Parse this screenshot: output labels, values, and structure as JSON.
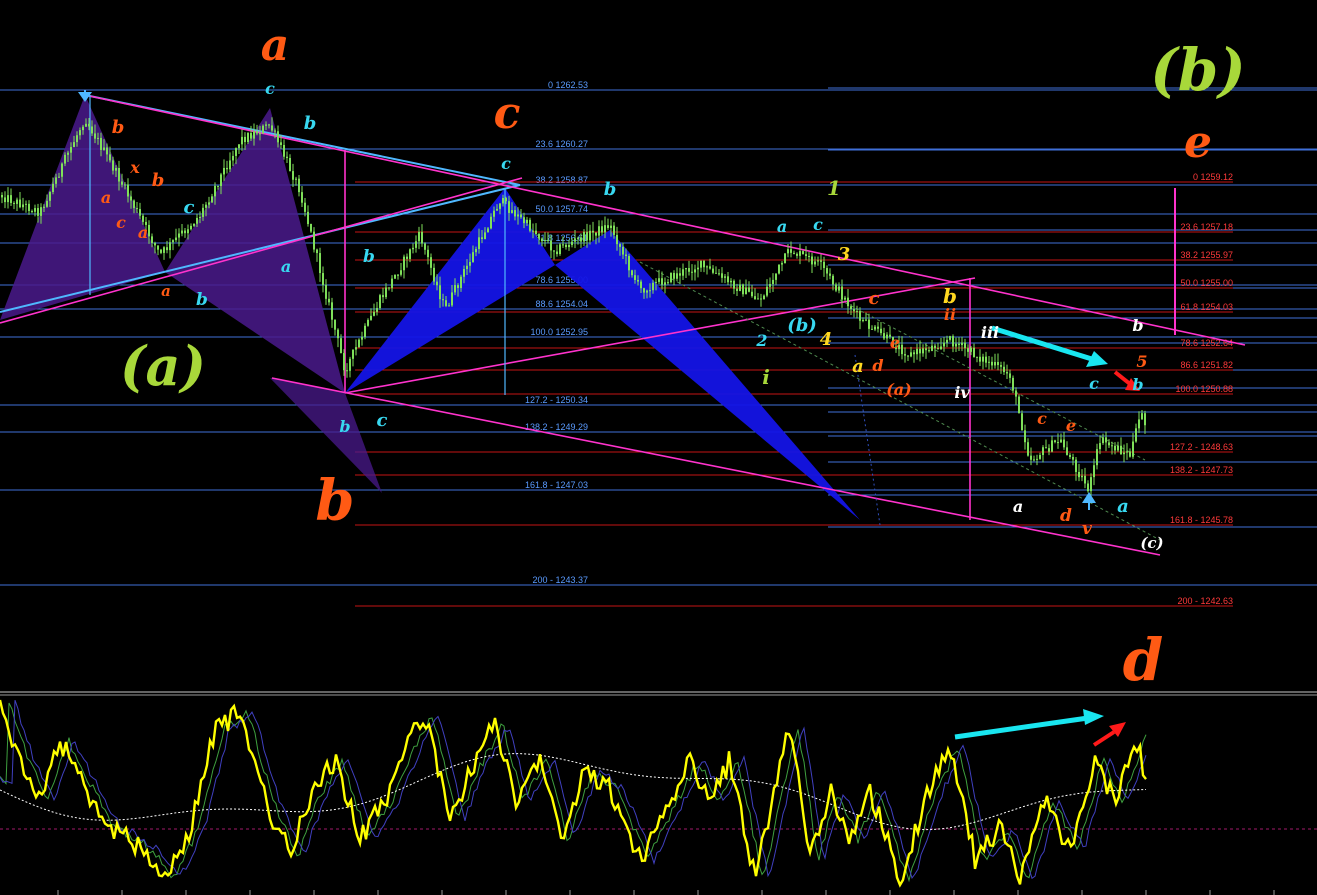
{
  "chart_data": [
    {
      "type": "line",
      "title": "",
      "description_note": "",
      "fib_left": [
        {
          "label": "0 1262.53"
        },
        {
          "label": "23.6 1260.27"
        },
        {
          "label": "38.2 1258.87"
        },
        {
          "label": "50.0 1257.74"
        },
        {
          "label": "61.8 1256.61"
        },
        {
          "label": "78.6 1255.00"
        },
        {
          "label": "88.6 1254.04"
        },
        {
          "label": "100.0 1252.95"
        },
        {
          "label": "127.2 - 1250.34"
        },
        {
          "label": "138.2 - 1249.29"
        },
        {
          "label": "161.8 - 1247.03"
        },
        {
          "label": "200 - 1243.37"
        }
      ],
      "fib_right": [
        {
          "label": "0 1259.12"
        },
        {
          "label": "23.6 1257.18"
        },
        {
          "label": "38.2 1255.97"
        },
        {
          "label": "50.0 1255.00"
        },
        {
          "label": "61.8 1254.03"
        },
        {
          "label": "78.6 1252.64"
        },
        {
          "label": "86.6 1251.82"
        },
        {
          "label": "100.0 1250.88"
        },
        {
          "label": "127.2 - 1248.63"
        },
        {
          "label": "138.2 - 1247.73"
        },
        {
          "label": "161.8 - 1245.78"
        },
        {
          "label": "200 - 1242.63"
        }
      ],
      "wave_labels": {
        "big": [
          "a",
          "c",
          "b",
          "(a)",
          "(b)",
          "e",
          "d"
        ],
        "small": [
          "b",
          "x",
          "b",
          "a",
          "c",
          "a",
          "a",
          "c",
          "b",
          "c",
          "b",
          "a",
          "b",
          "c",
          "b",
          "c",
          "b",
          "a",
          "c",
          "(b)",
          "2",
          "1",
          "3",
          "4",
          "a",
          "b",
          "c",
          "d",
          "e",
          "(a)",
          "ii",
          "i",
          "iii",
          "iv",
          "a",
          "b",
          "c",
          "a",
          "b",
          "c",
          "d",
          "e",
          "v",
          "5",
          "(c)"
        ]
      }
    },
    {
      "type": "line",
      "title": "",
      "series": [
        {
          "color": "#ffff00"
        },
        {
          "color": "#3fa03f"
        },
        {
          "color": "#4040c0"
        },
        {
          "color": "#ffffff"
        }
      ]
    }
  ],
  "colors": {
    "background": "#000000",
    "candle": "#7fe05a",
    "fib_left": "#4b8cff",
    "fib_right": "#ff2a2a",
    "channel": "#ff33cc",
    "wave_orange": "#ff5a14",
    "wave_cyan": "#38d8f0",
    "wave_green": "#a8d83a",
    "wave_yellow": "#ffd820",
    "oscillator": "#ffff00",
    "arrow_cyan": "#19e6f0",
    "arrow_red": "#ff1a1a"
  }
}
